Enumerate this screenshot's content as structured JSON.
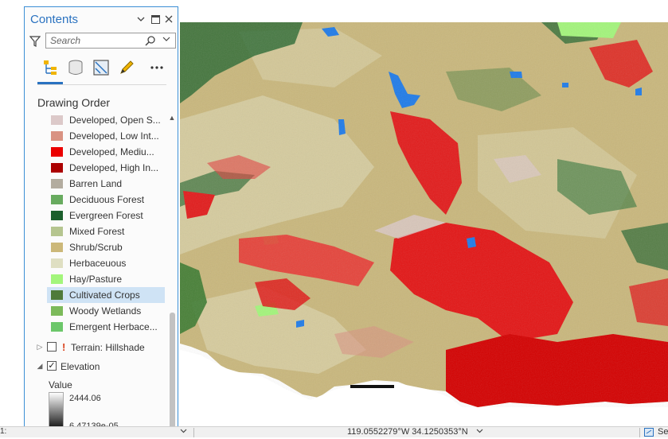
{
  "pane": {
    "title": "Contents",
    "search_placeholder": "Search",
    "section_label": "Drawing Order",
    "legend_items": [
      {
        "label": "Developed, Open S...",
        "color": "#dcc9c9"
      },
      {
        "label": "Developed, Low Int...",
        "color": "#d99282"
      },
      {
        "label": "Developed, Mediu...",
        "color": "#eb0000"
      },
      {
        "label": "Developed, High In...",
        "color": "#ab0000"
      },
      {
        "label": "Barren Land",
        "color": "#b3ac9f"
      },
      {
        "label": "Deciduous Forest",
        "color": "#68ab5f"
      },
      {
        "label": "Evergreen Forest",
        "color": "#1c5f2c"
      },
      {
        "label": "Mixed Forest",
        "color": "#b5c58f"
      },
      {
        "label": "Shrub/Scrub",
        "color": "#ccb879"
      },
      {
        "label": "Herbaceuous",
        "color": "#dfdfc2"
      },
      {
        "label": "Hay/Pasture",
        "color": "#a3f57b"
      },
      {
        "label": "Cultivated Crops",
        "color": "#4f7a3a"
      },
      {
        "label": "Woody Wetlands",
        "color": "#7cba5a"
      },
      {
        "label": "Emergent Herbace...",
        "color": "#6cc76a"
      }
    ],
    "selected_item": "Cultivated Crops",
    "layers": {
      "terrain": {
        "label": "Terrain: Hillshade",
        "checked": false
      },
      "elevation": {
        "label": "Elevation",
        "checked": true
      }
    },
    "elevation_legend": {
      "heading": "Value",
      "max": "2444.06",
      "min": "6.47139e-05"
    }
  },
  "status_bar": {
    "scale": "1:",
    "coordinates": "119.0552279°W 34.1250353°N",
    "selection_label": "Se"
  },
  "colors": {
    "accent": "#2a72c0",
    "shrub": "#ccb879",
    "developed_medium": "#eb0000",
    "water": "#1f7be8"
  },
  "icons": [
    "filter-icon",
    "search-icon",
    "chevron-down-icon",
    "dock-icon",
    "close-icon",
    "list-by-drawing-order-icon",
    "list-by-data-source-icon",
    "list-by-selection-icon",
    "list-by-editing-icon",
    "more-icon",
    "warning-icon"
  ]
}
